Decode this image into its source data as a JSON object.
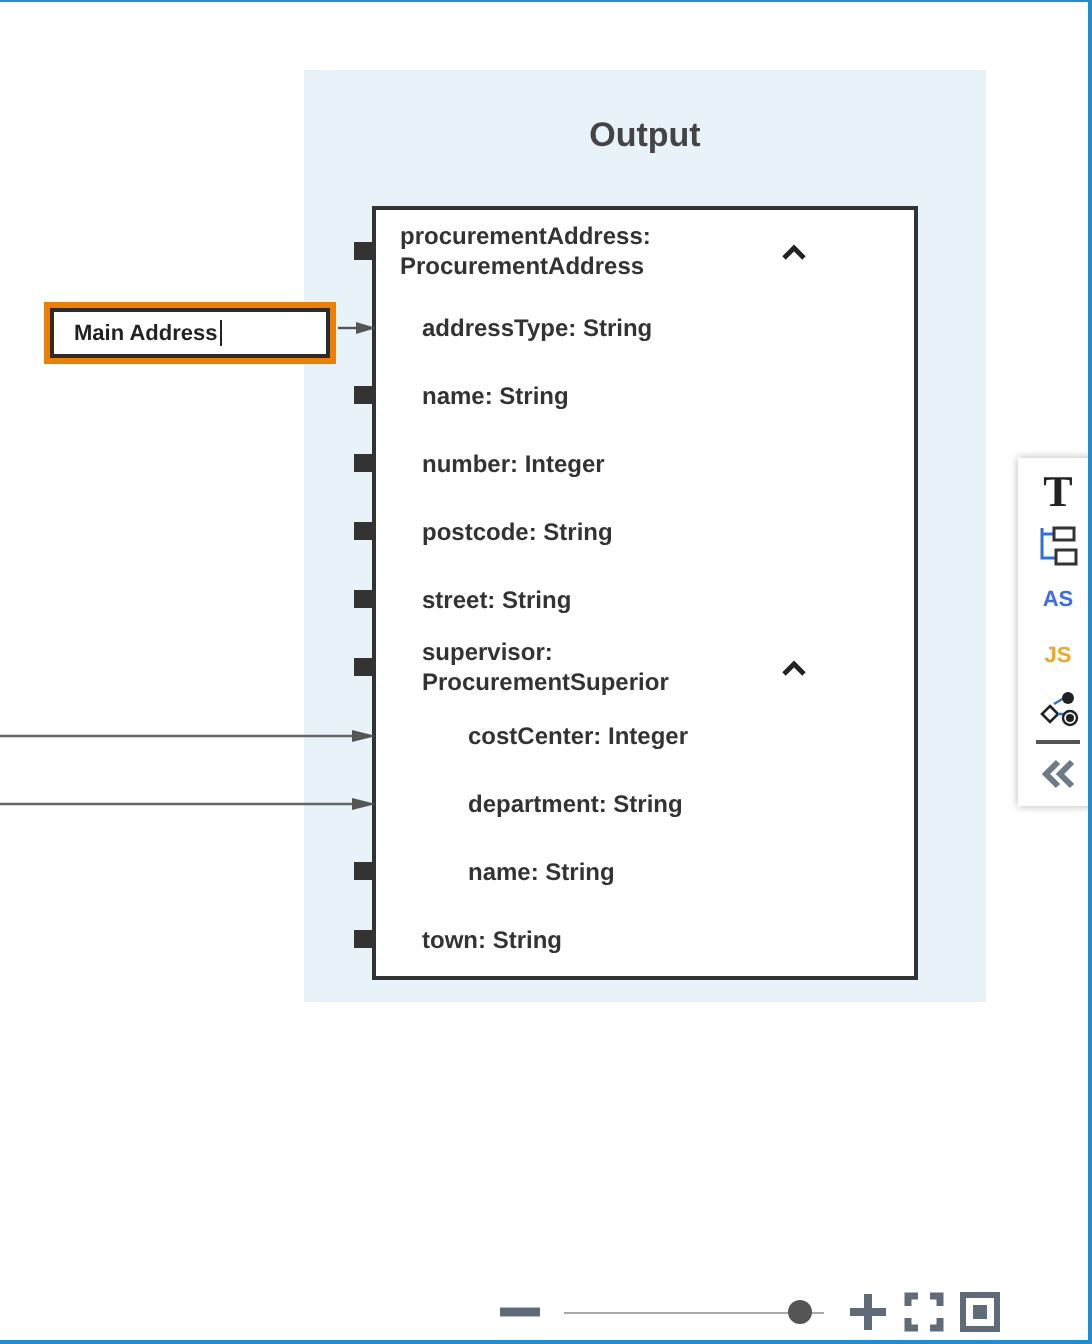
{
  "node": {
    "title": "Output",
    "fields": [
      {
        "label": "procurementAddress: ProcurementAddress",
        "kind": "port",
        "expanded": true,
        "children": [
          {
            "label": "addressType: String",
            "kind": "field-link"
          },
          {
            "label": "name: String",
            "kind": "port"
          },
          {
            "label": "number: Integer",
            "kind": "port"
          },
          {
            "label": "postcode: String",
            "kind": "port"
          },
          {
            "label": "street: String",
            "kind": "port"
          },
          {
            "label": "supervisor: ProcurementSuperior",
            "kind": "port",
            "expanded": true,
            "children": [
              {
                "label": "costCenter: Integer",
                "kind": "external-link"
              },
              {
                "label": "department: String",
                "kind": "external-link"
              },
              {
                "label": "name: String",
                "kind": "port"
              }
            ]
          },
          {
            "label": "town: String",
            "kind": "port"
          }
        ]
      }
    ]
  },
  "input_field": {
    "value": "Main Address",
    "focused": true
  },
  "toolbar": [
    {
      "kind": "glyph",
      "text": "T",
      "color": "#222222"
    },
    {
      "kind": "tree"
    },
    {
      "kind": "glyph",
      "text": "AS",
      "color": "#3a6cf4"
    },
    {
      "kind": "glyph",
      "text": "JS",
      "color": "#f5a623"
    },
    {
      "kind": "mapping"
    },
    {
      "kind": "collapse"
    }
  ]
}
